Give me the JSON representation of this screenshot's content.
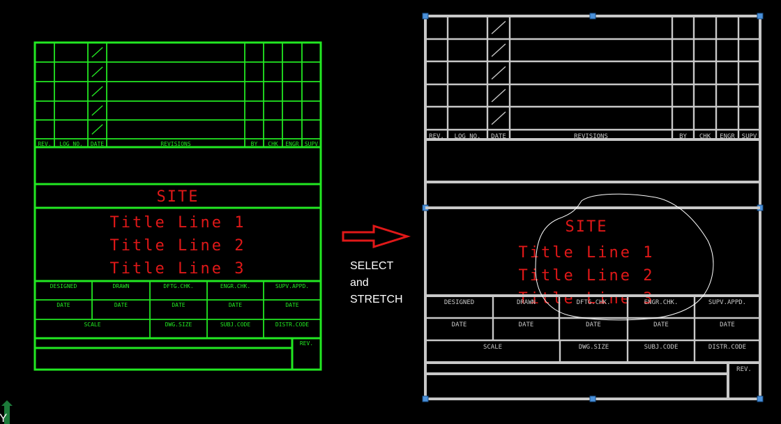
{
  "colors": {
    "background": "#000000",
    "left_frame": "#22e822",
    "right_frame": "#c8c8c8",
    "title_text": "#e01818",
    "grip": "#4a90d9",
    "arrow": "#e01818"
  },
  "title_block": {
    "revisions_header": [
      "REV.",
      "LOG NO.",
      "DATE",
      "REVISIONS",
      "BY",
      "CHK",
      "ENGR",
      "SUPV"
    ],
    "site": "SITE",
    "title_lines": [
      "Title Line 1",
      "Title Line 2",
      "Title Line 3"
    ],
    "signoff_row1": [
      "DESIGNED",
      "DRAWN",
      "DFTG.CHK.",
      "ENGR.CHK.",
      "SUPV.APPD."
    ],
    "signoff_row2": [
      "DATE",
      "DATE",
      "DATE",
      "DATE",
      "DATE"
    ],
    "signoff_row3": [
      "SCALE",
      "DWG.SIZE",
      "SUBJ.CODE",
      "DISTR.CODE"
    ],
    "rev_label": "REV."
  },
  "instructions": {
    "line1": "SELECT",
    "line2": "and",
    "line3": "STRETCH"
  },
  "ucs_icon": {
    "label": "Y",
    "name": "ucs-y-icon"
  }
}
